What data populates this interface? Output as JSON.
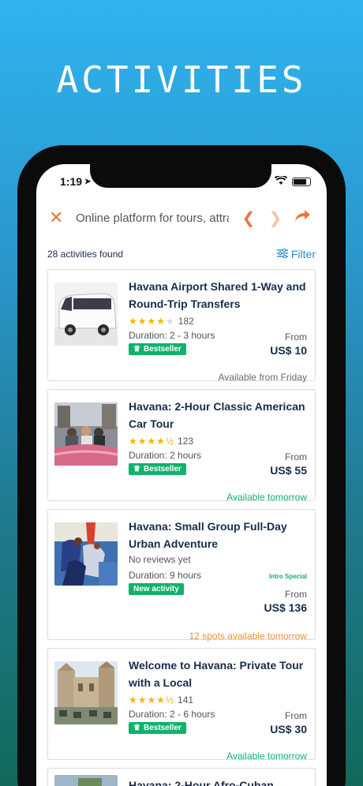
{
  "hero": {
    "title": "ACTIVITIES"
  },
  "status": {
    "time": "1:19"
  },
  "toolbar": {
    "url": "Online platform for tours, attra"
  },
  "results": {
    "count_label": "28 activities found",
    "filter_label": "Filter"
  },
  "activities": [
    {
      "title": "Havana Airport Shared 1-Way and Round-Trip Transfers",
      "rating": 4,
      "rating_count": "182",
      "duration": "Duration: 2 - 3 hours",
      "badge": "Bestseller",
      "price_from": "From",
      "price": "US$ 10",
      "availability": "Available from Friday",
      "availability_color": "#6b6b6b"
    },
    {
      "title": "Havana: 2-Hour Classic American Car Tour",
      "rating": 4.5,
      "rating_count": "123",
      "duration": "Duration: 2 hours",
      "badge": "Bestseller",
      "price_from": "From",
      "price": "US$ 55",
      "availability": "Available tomorrow",
      "availability_color": "#10b26c"
    },
    {
      "title": "Havana: Small Group Full-Day Urban Adventure",
      "no_reviews": "No reviews yet",
      "duration": "Duration: 9 hours",
      "badge": "New activity",
      "intro_special": "Intro Special",
      "price_from": "From",
      "price": "US$ 136",
      "availability": "12 spots available tomorrow",
      "availability_color": "#e8923a"
    },
    {
      "title": "Welcome to Havana: Private Tour with a Local",
      "rating": 4.5,
      "rating_count": "141",
      "duration": "Duration: 2 - 6 hours",
      "badge": "Bestseller",
      "price_from": "From",
      "price": "US$ 30",
      "availability": "Available tomorrow",
      "availability_color": "#10b26c"
    },
    {
      "title": "Havana: 2-Hour Afro-Cuban"
    }
  ],
  "colors": {
    "accent": "#e8763a",
    "green": "#10b26c",
    "link": "#2a8fd0",
    "navy": "#1a2b49"
  }
}
